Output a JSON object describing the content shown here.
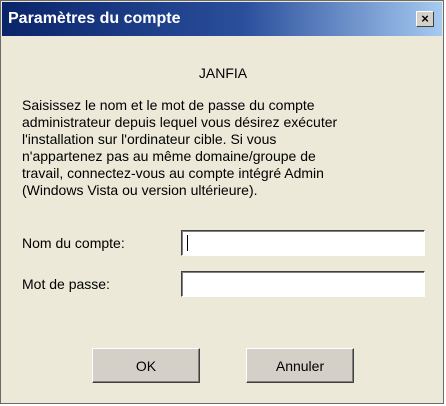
{
  "window": {
    "title": "Paramètres du compte",
    "close_label": "×"
  },
  "app_name": "JANFIA",
  "description": [
    "Saisissez le nom et le mot de passe du compte",
    "administrateur depuis lequel vous désirez exécuter",
    "l'installation sur l'ordinateur cible. Si vous",
    "n'appartenez pas au même domaine/groupe de",
    "travail, connectez-vous au compte intégré Admin",
    "(Windows Vista ou version ultérieure)."
  ],
  "form": {
    "account_label": "Nom du compte:",
    "account_value": "",
    "password_label": "Mot de passe:",
    "password_value": ""
  },
  "buttons": {
    "ok_label": "OK",
    "cancel_label": "Annuler"
  }
}
